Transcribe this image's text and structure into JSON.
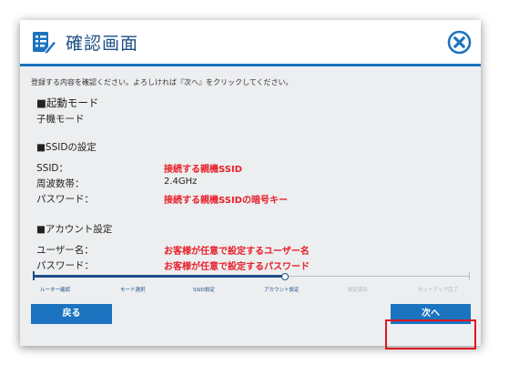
{
  "dialog": {
    "title": "確認画面",
    "icon": "checklist-edit-icon",
    "close_icon": "close-circle-icon"
  },
  "instruction": "登録する内容を確認ください。よろしければ『次へ』をクリックしてください。",
  "sections": {
    "startup": {
      "heading": "■起動モード",
      "value": "子機モード"
    },
    "ssid": {
      "heading": "■SSIDの設定",
      "rows": [
        {
          "label": "SSID：",
          "value": "接続する親機SSID"
        },
        {
          "label": "周波数帯：",
          "value": "2.4GHz"
        },
        {
          "label": "パスワード：",
          "value": "接続する親機SSIDの暗号キー"
        }
      ]
    },
    "account": {
      "heading": "■アカウント設定",
      "rows": [
        {
          "label": "ユーザー名：",
          "value": "お客様が任意で設定するユーザー名"
        },
        {
          "label": "パスワード：",
          "value": "お客様が任意で設定するパスワード"
        }
      ]
    }
  },
  "progress": {
    "current_step": 4,
    "total_steps": 6,
    "steps": [
      "ルーター確認",
      "モード選択",
      "SSID設定",
      "アカウント設定",
      "設定保存",
      "セットアップ完了"
    ]
  },
  "buttons": {
    "back": "戻る",
    "next": "次へ"
  },
  "colors": {
    "accent": "#1c73bf",
    "title_text": "#1c4f86",
    "value_red": "#e8202a",
    "highlight": "#e0141e",
    "content_bg": "#eceef0"
  }
}
